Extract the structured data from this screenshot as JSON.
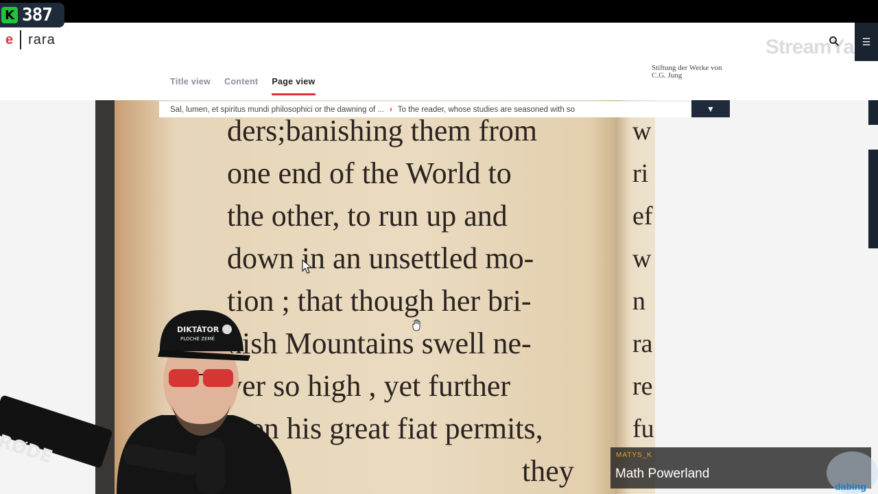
{
  "stream": {
    "viewer_badge_letter": "K",
    "viewer_count": "387",
    "streamyard_label": "StreamYard",
    "presenter_name": "Math Powerland",
    "presenter_tag": "MATYS_K",
    "mic_brand": "RØDE",
    "cap_text_line1": "DIKTÁTOR",
    "cap_text_line2": "PLOCHÉ ZEMĚ",
    "corner_logo_text": "dabing"
  },
  "site": {
    "logo_letter": "e",
    "logo_name": "rara",
    "foundation_line1": "Stiftung der Werke von",
    "foundation_line2": "C.G. Jung"
  },
  "tabs": [
    {
      "label": "Title view",
      "active": false
    },
    {
      "label": "Content",
      "active": false
    },
    {
      "label": "Page view",
      "active": true
    }
  ],
  "breadcrumb": {
    "part1": "Sal, lumen, et spiritus mundi philosophici or the dawning of ...",
    "part2": "To the reader, whose studies are seasoned with so"
  },
  "page_text": {
    "lines": [
      "ders;banishing them from",
      "one end of the World to",
      "the other, to run up and",
      "down in an unsettled mo-",
      "tion ; that though her bri-",
      "nish Mountains swell ne-",
      "ver so high , yet further",
      "then his great fiat permits,",
      "they"
    ],
    "right_column_letters": [
      "w",
      "ri",
      "ef",
      "w",
      "n",
      "ra",
      "re",
      "fu"
    ]
  },
  "colors": {
    "accent": "#e0313a",
    "nav_dark": "#1f2a3a",
    "parchment": "#eadbc0",
    "k_logo": "#22c23b"
  }
}
